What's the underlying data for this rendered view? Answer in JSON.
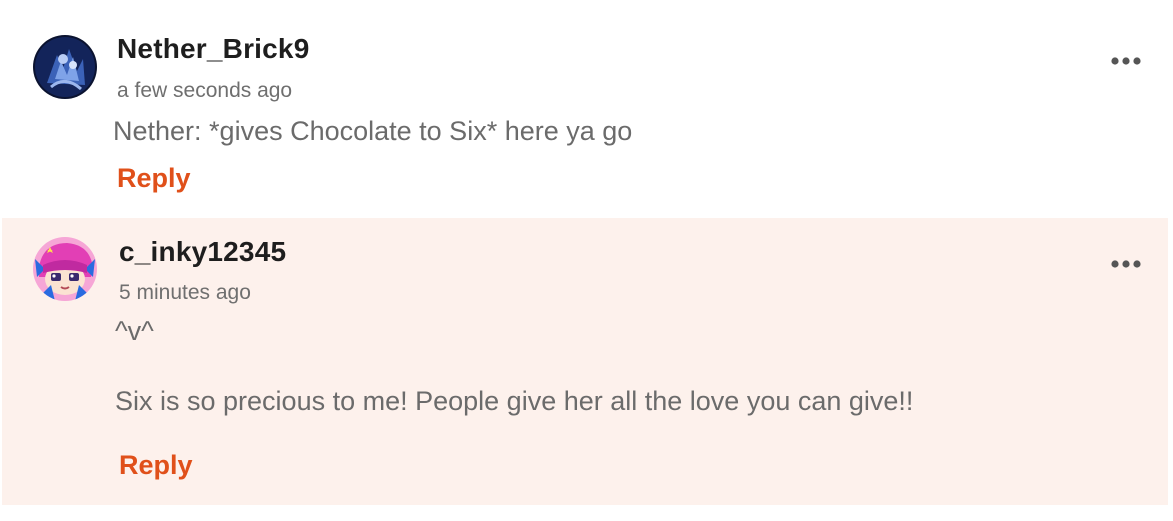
{
  "comments": [
    {
      "username": "Nether_Brick9",
      "timestamp": "a few seconds ago",
      "body": "Nether: *gives Chocolate to Six* here ya go",
      "reply_label": "Reply",
      "avatar_icon": "user-avatar-dark-blue",
      "menu_icon": "more-options-icon",
      "highlighted": false
    },
    {
      "username": "c_inky12345",
      "timestamp": "5 minutes ago",
      "body": "^v^\n\nSix is so precious to me! People give her all the love you can give!!",
      "reply_label": "Reply",
      "avatar_icon": "user-avatar-pink-anime",
      "menu_icon": "more-options-icon",
      "highlighted": true
    }
  ],
  "colors": {
    "reply": "#e0501a",
    "highlight_bg": "#fdf1ec",
    "username": "#1e1e1e",
    "meta": "#6f6f6f"
  }
}
